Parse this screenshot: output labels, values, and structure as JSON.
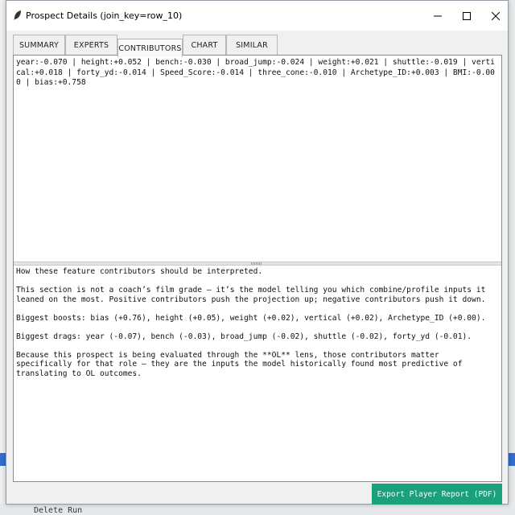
{
  "window": {
    "title": "Prospect Details (join_key=row_10)"
  },
  "tabs": [
    {
      "label": "SUMMARY"
    },
    {
      "label": "EXPERTS"
    },
    {
      "label": "CONTRIBUTORS",
      "active": true
    },
    {
      "label": "CHART"
    },
    {
      "label": "SIMILAR"
    }
  ],
  "contributors_text": "year:-0.070 | height:+0.052 | bench:-0.030 | broad_jump:-0.024 | weight:+0.021 | shuttle:-0.019 | vertical:+0.018 | forty_yd:-0.014 | Speed_Score:-0.014 | three_cone:-0.010 | Archetype_ID:+0.003 | BMI:-0.000 | bias:+0.758",
  "interpretation": {
    "heading": "How these feature contributors should be interpreted.",
    "paragraph1": "This section is not a coach’s film grade — it’s the model telling you which combine/profile inputs it leaned on the most. Positive contributors push the projection up; negative contributors push it down.",
    "boosts": "Biggest boosts: bias (+0.76), height (+0.05), weight (+0.02), vertical (+0.02), Archetype_ID (+0.00).",
    "drags": "Biggest drags: year (-0.07), bench (-0.03), broad_jump (-0.02), shuttle (-0.02), forty_yd (-0.01).",
    "lens": "Because this prospect is being evaluated through the **OL** lens, those contributors matter specifically for that role — they are the inputs the model historically found most predictive of translating to OL outcomes."
  },
  "export_button": "Export Player Report (PDF)",
  "background": {
    "bottom_label": "Delete Run"
  },
  "colors": {
    "accent_button": "#1aa07a",
    "selection_blue": "#2f6fd1"
  }
}
